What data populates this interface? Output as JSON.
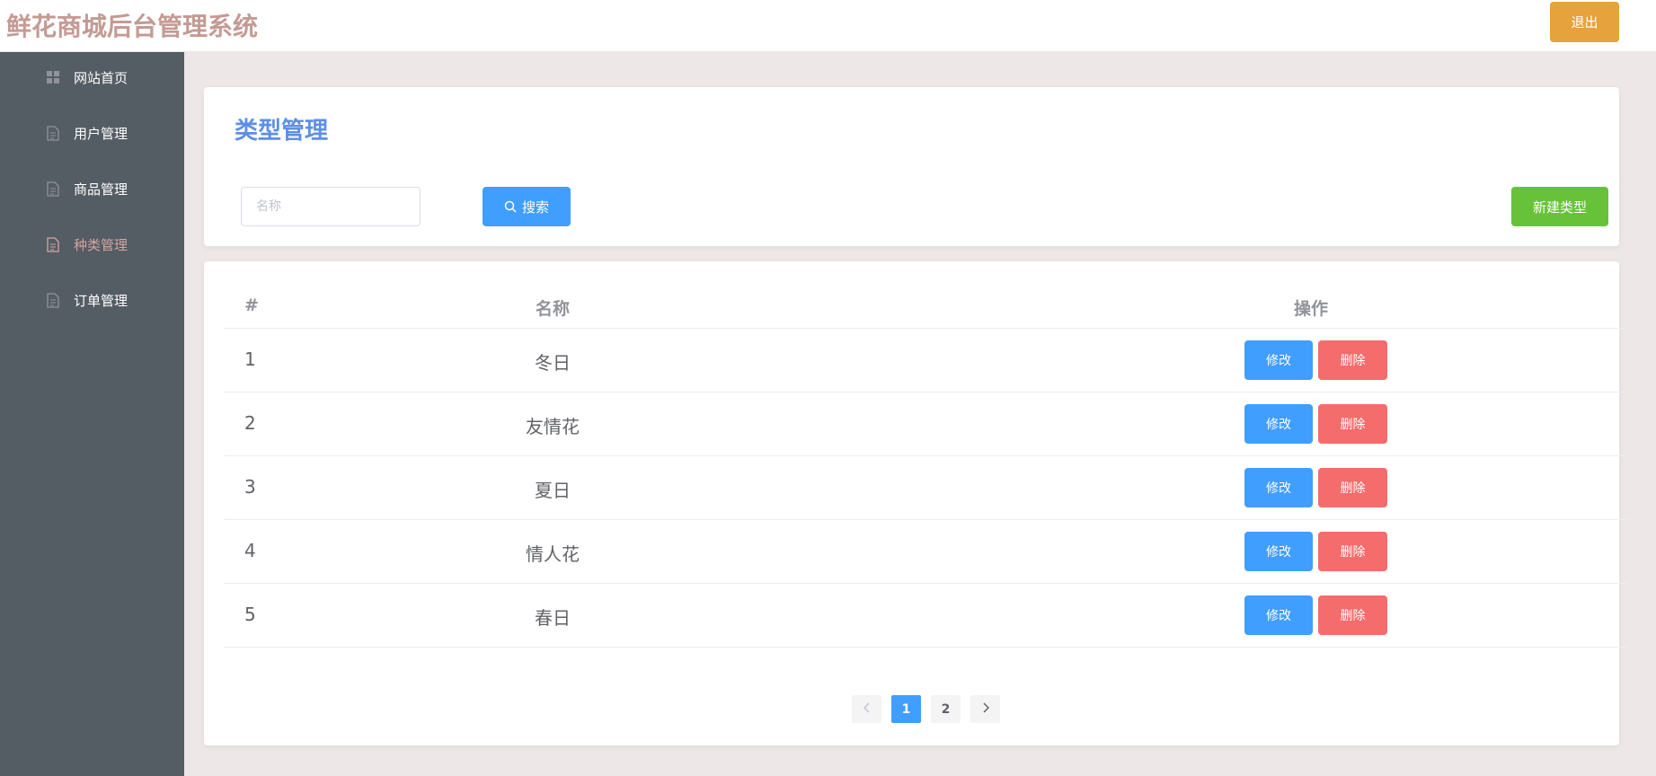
{
  "header": {
    "title": "鲜花商城后台管理系统",
    "logout_label": "退出"
  },
  "sidebar": {
    "items": [
      {
        "label": "网站首页",
        "icon": "grid-icon"
      },
      {
        "label": "用户管理",
        "icon": "document-icon"
      },
      {
        "label": "商品管理",
        "icon": "document-icon"
      },
      {
        "label": "种类管理",
        "icon": "document-icon",
        "active": true
      },
      {
        "label": "订单管理",
        "icon": "document-icon"
      }
    ]
  },
  "toolbar": {
    "page_title": "类型管理",
    "search_placeholder": "名称",
    "search_value": "",
    "search_label": "搜索",
    "new_label": "新建类型"
  },
  "table": {
    "columns": [
      "#",
      "名称",
      "操作"
    ],
    "rows": [
      {
        "index": "1",
        "name": "冬日"
      },
      {
        "index": "2",
        "name": "友情花"
      },
      {
        "index": "3",
        "name": "夏日"
      },
      {
        "index": "4",
        "name": "情人花"
      },
      {
        "index": "5",
        "name": "春日"
      }
    ],
    "edit_label": "修改",
    "delete_label": "删除"
  },
  "pagination": {
    "pages": [
      "1",
      "2"
    ],
    "current": "1"
  },
  "colors": {
    "title": "#c49a93",
    "accent": "#409eff",
    "success": "#67c23a",
    "danger": "#f56c6c",
    "warning": "#e6a23c",
    "sidebar_bg": "#545c64",
    "active_menu": "#d4a5a0",
    "page_title": "#5d8fe6"
  }
}
